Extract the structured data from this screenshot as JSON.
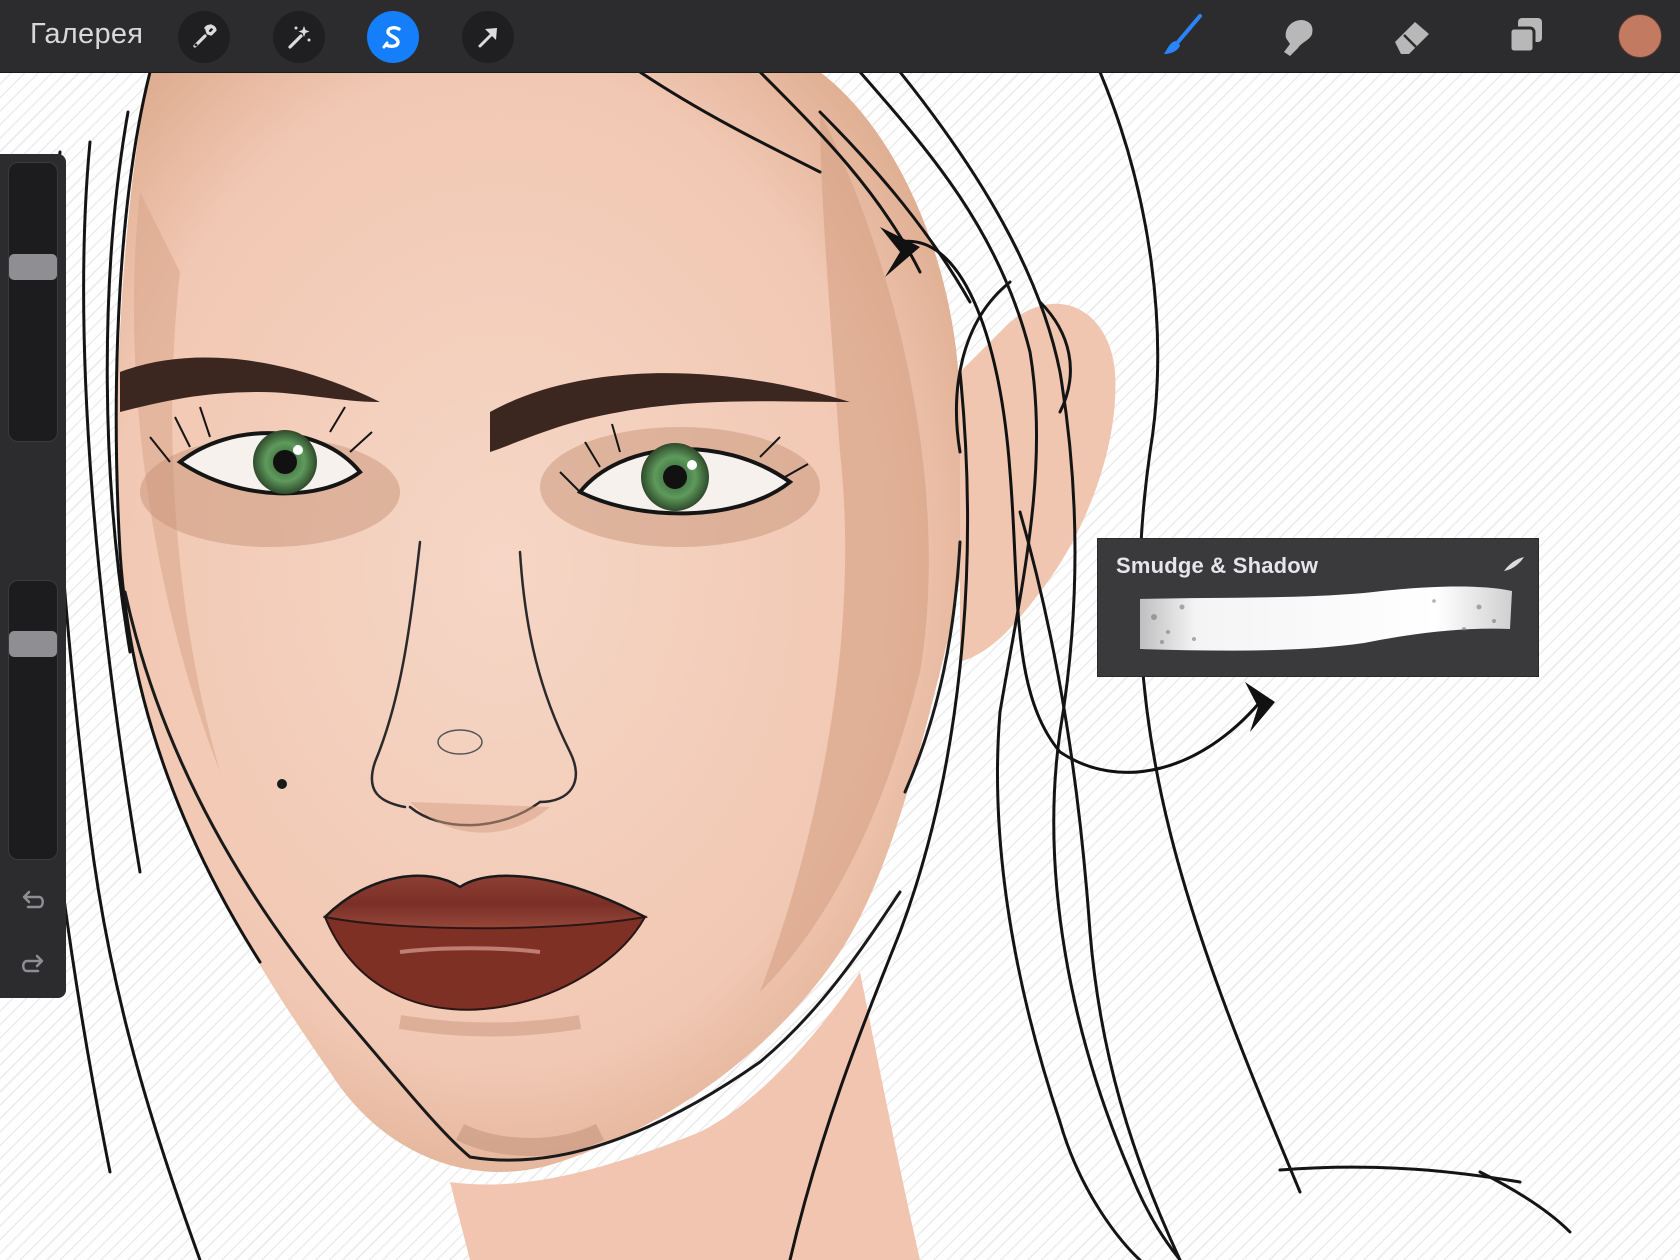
{
  "toolbar": {
    "gallery_label": "Галерея",
    "left_tools": [
      {
        "name": "actions",
        "icon": "wrench-icon",
        "active": false
      },
      {
        "name": "adjustments",
        "icon": "magic-wand-icon",
        "active": false
      },
      {
        "name": "selection",
        "icon": "selection-s-icon",
        "active": true
      },
      {
        "name": "transform",
        "icon": "arrow-cursor-icon",
        "active": false
      }
    ],
    "right_tools": [
      {
        "name": "brush",
        "icon": "brush-icon",
        "active": true
      },
      {
        "name": "smudge",
        "icon": "smudge-finger-icon",
        "active": false
      },
      {
        "name": "eraser",
        "icon": "eraser-icon",
        "active": false
      },
      {
        "name": "layers",
        "icon": "layers-icon",
        "active": false
      }
    ],
    "active_color": "#c27b61",
    "accent_color": "#147efb"
  },
  "sidebar": {
    "brush_size_level": 0.64,
    "opacity_level": 0.8,
    "undo_icon": "undo-arrow-icon",
    "redo_icon": "redo-arrow-icon"
  },
  "brush_popup": {
    "name": "Smudge & Shadow",
    "icon": "brush-stroke-icon"
  }
}
